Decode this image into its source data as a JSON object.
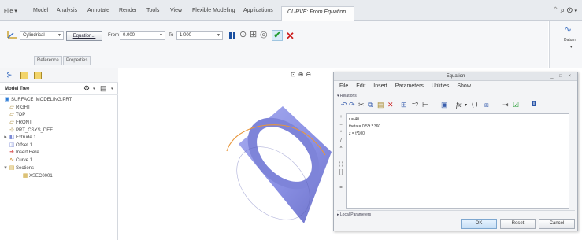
{
  "ribbon": {
    "file_label": "File ▾",
    "tabs": [
      "Model",
      "Analysis",
      "Annotate",
      "Render",
      "Tools",
      "View",
      "Flexible Modeling",
      "Applications"
    ],
    "active_tab": "CURVE: From Equation"
  },
  "dashboard": {
    "curve_type": "Cylindrical",
    "equation_button": "Equation...",
    "from_label": "From",
    "from_value": "0.000",
    "to_label": "To",
    "to_value": "1.000",
    "panels": [
      "Reference",
      "Properties"
    ]
  },
  "datum_group": {
    "label": "Datum",
    "dropdown": "▾"
  },
  "model_tree": {
    "title": "Model Tree",
    "items": [
      {
        "icon": "part",
        "label": "SURFACE_MODELING.PRT"
      },
      {
        "icon": "plane",
        "label": "RIGHT"
      },
      {
        "icon": "plane",
        "label": "TOP"
      },
      {
        "icon": "plane",
        "label": "FRONT"
      },
      {
        "icon": "csys",
        "label": "PRT_CSYS_DEF"
      },
      {
        "icon": "extrude",
        "label": "Extrude 1",
        "expander": "▸"
      },
      {
        "icon": "offset",
        "label": "Offset 1"
      },
      {
        "icon": "insert",
        "label": "Insert Here"
      },
      {
        "icon": "curve",
        "label": "Curve 1"
      },
      {
        "icon": "sections",
        "label": "Sections",
        "expander": "▾"
      },
      {
        "icon": "section",
        "label": "XSEC0001"
      }
    ]
  },
  "equation_dialog": {
    "title": "Equation",
    "window_buttons": "_ □ ×",
    "menu": [
      "File",
      "Edit",
      "Insert",
      "Parameters",
      "Utilities",
      "Show"
    ],
    "relations_label": "Relations",
    "lines": [
      "r = 40",
      "theta = 0.5*t * 360",
      "z = t*100"
    ],
    "local_parameters_label": "Local Parameters",
    "ok": "OK",
    "reset": "Reset",
    "cancel": "Cancel"
  },
  "colors": {
    "ribbon_bg": "#e8ebef",
    "cylinder_fill": "#8d93e8",
    "curve_orange": "#e8963b",
    "ok_check": "#1f9a2e",
    "cancel_x": "#cc1f1f"
  }
}
